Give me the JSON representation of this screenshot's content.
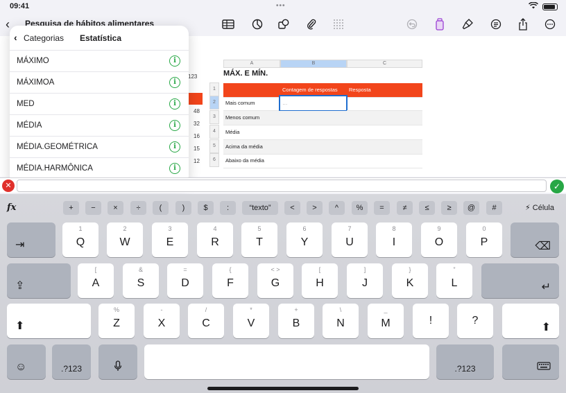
{
  "status": {
    "time": "09:41"
  },
  "document": {
    "title": "Pesquisa de hábitos alimentares"
  },
  "popover": {
    "back_label": "Categorias",
    "title": "Estatística",
    "functions": [
      "MÁXIMO",
      "MÁXIMOA",
      "MED",
      "MÉDIA",
      "MÉDIA.GEOMÉTRICA",
      "MÉDIA.HARMÔNICA"
    ]
  },
  "sheet": {
    "title": "MÁX. E MÍN.",
    "columns": [
      "A",
      "B",
      "C"
    ],
    "rows": [
      "1",
      "2",
      "3",
      "4",
      "5",
      "6"
    ],
    "header_row": [
      "",
      "Contagem de respostas",
      "Resposta"
    ],
    "labels": [
      "Mais comum",
      "Menos comum",
      "Média",
      "Acima da média",
      "Abaixo da média"
    ],
    "active_cell_value": "…",
    "background_values": [
      "123",
      "48",
      "32",
      "16",
      "15",
      "12"
    ]
  },
  "formula_ops": [
    "+",
    "−",
    "×",
    "÷",
    "(",
    ")",
    "$",
    ":",
    "“texto”",
    "<",
    ">",
    "^",
    "%",
    "=",
    "≠",
    "≤",
    "≥",
    "@",
    "#"
  ],
  "formula_cell_label": "Célula",
  "keyboard": {
    "row1": [
      [
        "1",
        "Q"
      ],
      [
        "2",
        "W"
      ],
      [
        "3",
        "E"
      ],
      [
        "4",
        "R"
      ],
      [
        "5",
        "T"
      ],
      [
        "6",
        "Y"
      ],
      [
        "7",
        "U"
      ],
      [
        "8",
        "I"
      ],
      [
        "9",
        "O"
      ],
      [
        "0",
        "P"
      ]
    ],
    "row2": [
      [
        "[",
        "A"
      ],
      [
        "&",
        "S"
      ],
      [
        "=",
        "D"
      ],
      [
        "{",
        "F"
      ],
      [
        "< >",
        "G"
      ],
      [
        "[",
        "H"
      ],
      [
        "]",
        "J"
      ],
      [
        "}",
        "K"
      ],
      [
        "”",
        "L"
      ]
    ],
    "row3": [
      [
        "%",
        "Z"
      ],
      [
        "-",
        "X"
      ],
      [
        "/",
        "C"
      ],
      [
        "*",
        "V"
      ],
      [
        "+",
        "B"
      ],
      [
        "\\",
        "N"
      ],
      [
        "_",
        "M"
      ],
      [
        "",
        "!"
      ],
      [
        "",
        "?"
      ]
    ],
    "numbers_label": ".?123"
  }
}
